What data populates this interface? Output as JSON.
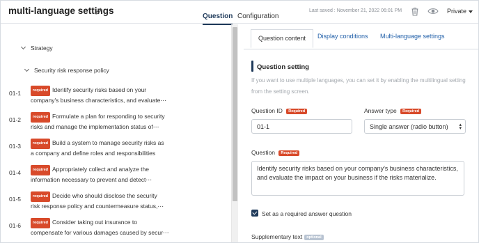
{
  "header": {
    "title": "multi-language settings",
    "tabs": [
      "Question",
      "Configuration"
    ],
    "last_saved": "Last saved : November 21, 2022 06:01 PM",
    "visibility": "Private"
  },
  "tree": {
    "root": "Strategy",
    "group": "Security risk response policy",
    "badge": "required",
    "items": [
      {
        "id": "01-1",
        "line1": "Identify security risks based on your",
        "line2": "company's business characteristics, and evaluate⋯"
      },
      {
        "id": "01-2",
        "line1": "Formulate a plan for responding to security",
        "line2": "risks and manage the implementation status of⋯"
      },
      {
        "id": "01-3",
        "line1": "Build a system to manage security risks as",
        "line2": "a company and define roles and responsibilities"
      },
      {
        "id": "01-4",
        "line1": "Appropriately collect and analyze the",
        "line2": "information necessary to prevent and detect⋯"
      },
      {
        "id": "01-5",
        "line1": "Decide who should disclose the security",
        "line2": "risk response policy and countermeasure status,⋯"
      },
      {
        "id": "01-6",
        "line1": "Consider taking out insurance to",
        "line2": "compensate for various damages caused by secur⋯"
      }
    ]
  },
  "panel": {
    "tabs": [
      "Question content",
      "Display conditions",
      "Multi-language settings"
    ],
    "section_title": "Question setting",
    "hint": "If you want to use multiple languages, you can set it by enabling the multilingual setting from the setting screen.",
    "required_badge": "Required",
    "question_id_label": "Question ID",
    "question_id_value": "01-1",
    "answer_type_label": "Answer type",
    "answer_type_value": "Single answer (radio button)",
    "question_label": "Question",
    "question_text": "Identify security risks based on your company's business characteristics, and evaluate the impact on your business if the risks materialize.",
    "required_check_label": "Set as a required answer question",
    "supplementary_label": "Supplementary text",
    "optional_badge": "optional"
  },
  "colors": {
    "primary": "#1f3a5a",
    "required": "#d84a2a",
    "link": "#1f5ea8",
    "optional": "#b9c4d2"
  },
  "icons": [
    "pencil-icon",
    "trash-icon",
    "eye-icon",
    "chevron-down-icon",
    "caret-down-icon",
    "checkmark-icon"
  ]
}
